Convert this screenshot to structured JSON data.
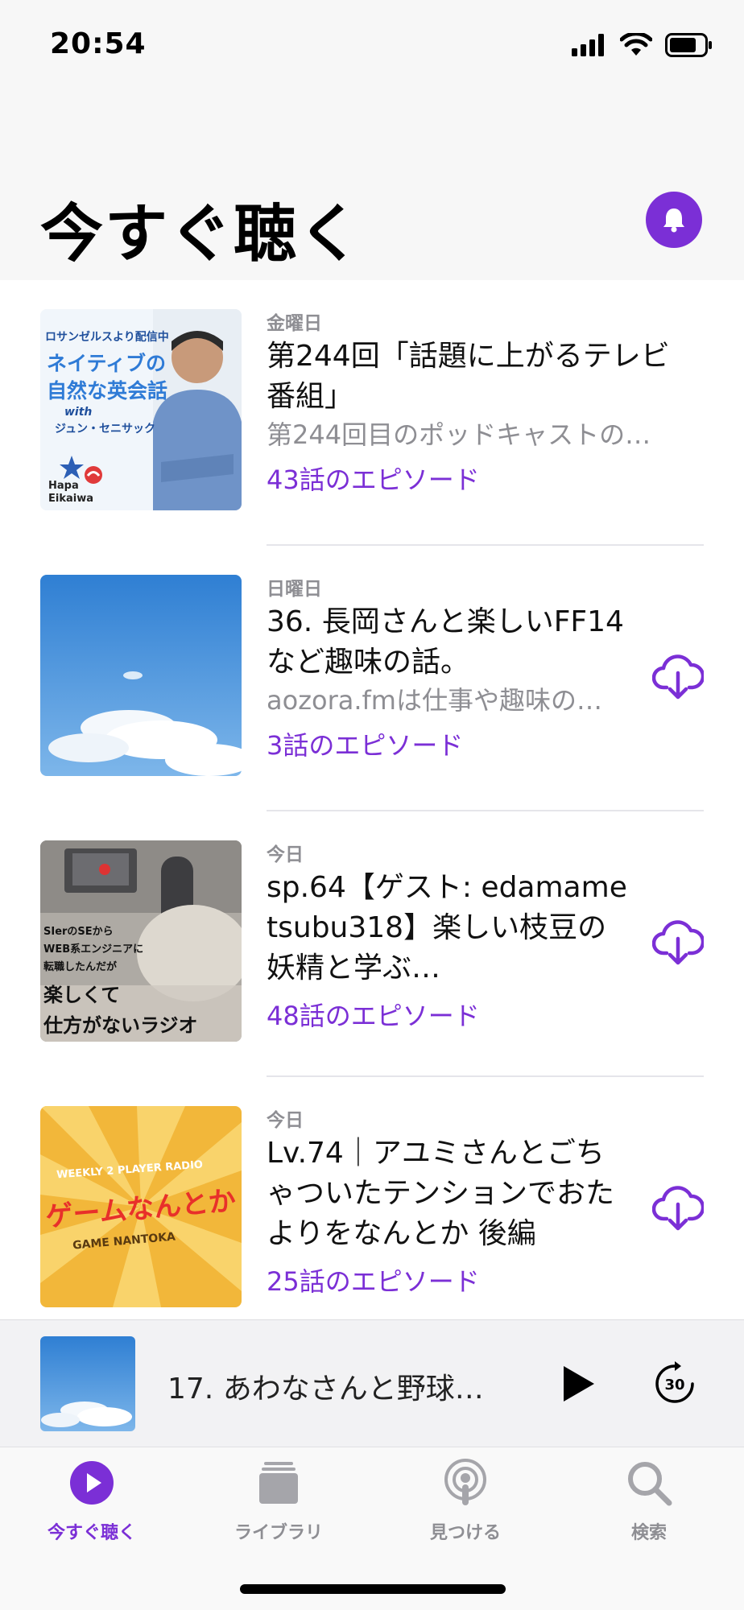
{
  "status_bar": {
    "time": "20:54"
  },
  "header": {
    "title": "今すぐ聴く"
  },
  "episodes": [
    {
      "day": "金曜日",
      "title": "第244回「話題に上がるテレビ番組」",
      "description": "第244回目のポッドキャストの…",
      "count": "43話のエピソード",
      "artwork": {
        "line1": "ロサンゼルスより配信中",
        "line2": "ネイティブの",
        "line3": "自然な英会話",
        "line4": "with",
        "line5": "ジュン・セニサック",
        "brand1": "Hapa",
        "brand2": "Eikaiwa"
      }
    },
    {
      "day": "日曜日",
      "title": "36. 長岡さんと楽しいFF14など趣味の話。",
      "description": "aozora.fmは仕事や趣味の…",
      "count": "3話のエピソード"
    },
    {
      "day": "今日",
      "title": "sp.64【ゲスト: edamametsubu318】楽しい枝豆の妖精と学ぶ…",
      "count": "48話のエピソード",
      "artwork": {
        "line1": "SIerのSEから",
        "line2": "WEB系エンジニアに",
        "line3": "転職したんだが",
        "line4": "楽しくて",
        "line5": "仕方がないラジオ"
      }
    },
    {
      "day": "今日",
      "title": "Lv.74｜アユミさんとごちゃついたテンションでおたよりをなんとか 後編",
      "count": "25話のエピソード",
      "artwork": {
        "line1": "WEEKLY 2 PLAYER RADIO",
        "line2": "ゲームなんとか",
        "line3": "GAME NANTOKA"
      }
    }
  ],
  "mini_player": {
    "title": "17. あわなさんと野球…",
    "skip_seconds": "30"
  },
  "tab_bar": {
    "tabs": [
      {
        "label": "今すぐ聴く",
        "icon": "play-circle-icon",
        "active": true
      },
      {
        "label": "ライブラリ",
        "icon": "library-icon",
        "active": false
      },
      {
        "label": "見つける",
        "icon": "podcasts-icon",
        "active": false
      },
      {
        "label": "検索",
        "icon": "search-icon",
        "active": false
      }
    ]
  },
  "colors": {
    "accent": "#7b2fd6",
    "secondary_text": "#8e8e93",
    "divider": "#e5e5ea"
  }
}
